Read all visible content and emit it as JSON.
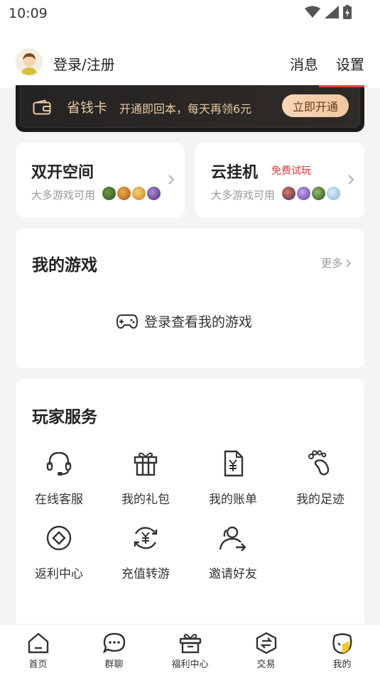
{
  "status_bar": {
    "time": "10:09"
  },
  "header": {
    "login_label": "登录/注册",
    "messages_label": "消息",
    "settings_label": "设置"
  },
  "vip_card": {
    "title": "省钱卡",
    "description": "开通即回本，每天再领6元",
    "button_label": "立即开通",
    "colors": {
      "background": "#1c1c1e",
      "text": "#e8c9a3",
      "button": "#f4cfaa"
    }
  },
  "tiles": [
    {
      "title": "双开空间",
      "subtitle": "大多游戏可用",
      "badge": ""
    },
    {
      "title": "云挂机",
      "subtitle": "大多游戏可用",
      "badge": "免费试玩"
    }
  ],
  "my_games": {
    "title": "我的游戏",
    "more_label": "更多",
    "empty_label": "登录查看我的游戏"
  },
  "player_services": {
    "title": "玩家服务",
    "items": [
      {
        "label": "在线客服",
        "icon": "headset-icon"
      },
      {
        "label": "我的礼包",
        "icon": "gift-icon"
      },
      {
        "label": "我的账单",
        "icon": "bill-icon"
      },
      {
        "label": "我的足迹",
        "icon": "footprint-icon"
      },
      {
        "label": "返利中心",
        "icon": "rebate-icon"
      },
      {
        "label": "充值转游",
        "icon": "recharge-transfer-icon"
      },
      {
        "label": "邀请好友",
        "icon": "invite-friend-icon"
      }
    ]
  },
  "tab_bar": {
    "tabs": [
      {
        "label": "首页",
        "icon": "home-icon"
      },
      {
        "label": "群聊",
        "icon": "chat-icon"
      },
      {
        "label": "福利中心",
        "icon": "welfare-icon"
      },
      {
        "label": "交易",
        "icon": "trade-icon"
      },
      {
        "label": "我的",
        "icon": "profile-icon"
      }
    ],
    "active_index": 4
  }
}
